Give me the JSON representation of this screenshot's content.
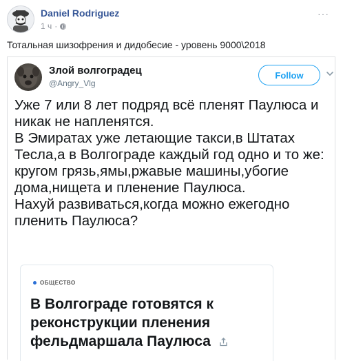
{
  "post": {
    "author": "Daniel Rodriguez",
    "time": "1 ч",
    "separator": "·",
    "text": "Тотальная шизофрения и дидобесие - уровень 9000\\2018",
    "more": "···"
  },
  "tweet": {
    "name": "Злой волгоградец",
    "handle": "@Angry_Vlg",
    "follow_label": "Follow",
    "body": "Уже 7 или 8 лет подряд всё пленят Паулюса и никак не напленятся.\nВ Эмиратах уже летающие такси,в Штатах Тесла,а в Волгограде каждый год одно и то же: кругом грязь,ямы,ржавые машины,убогие дома,нищета и пленение Паулюса.\nНахуй развиваться,когда можно ежегодно пленить Паулюса?"
  },
  "article": {
    "section": "ОБЩЕСТВО",
    "title": "В Волгограде готовятся к реконструкции пленения фельдмаршала Паулюса"
  },
  "colors": {
    "link": "#385898",
    "twitter_blue": "#1da1f2",
    "meta": "#90949c",
    "section_dot": "#2b6fd6"
  },
  "icons": [
    "avatar-mascot-icon",
    "globe-icon",
    "more-icon",
    "chevron-down-icon",
    "share-icon"
  ]
}
